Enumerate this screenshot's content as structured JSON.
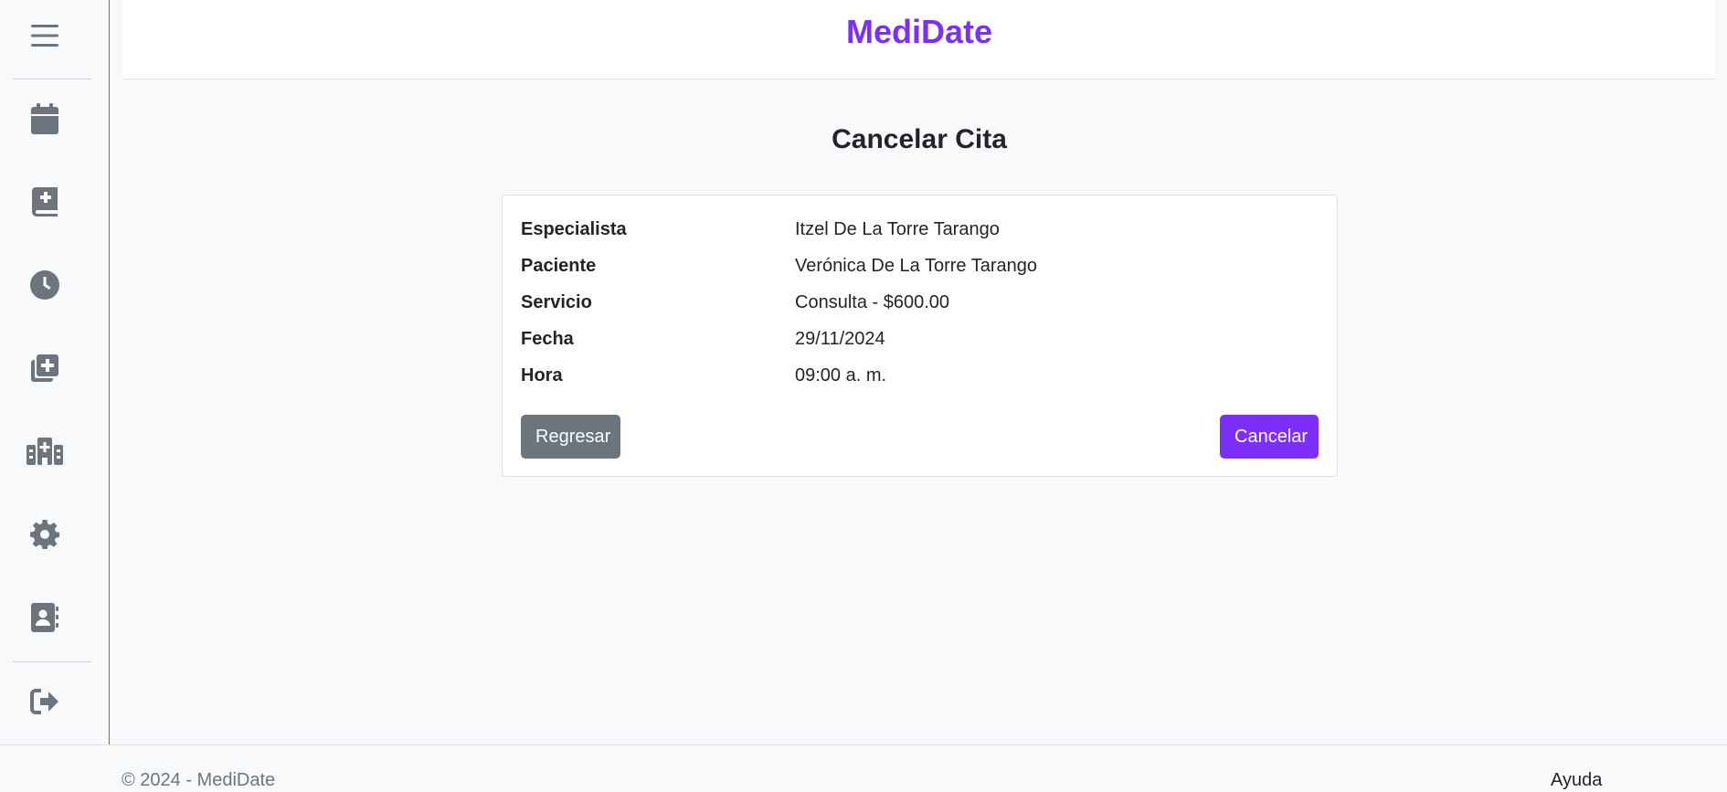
{
  "app": {
    "brand": "MediDate"
  },
  "sidebar": {
    "items": [
      {
        "icon": "menu-icon"
      },
      {
        "icon": "calendar-icon"
      },
      {
        "icon": "medical-book-icon"
      },
      {
        "icon": "clock-icon"
      },
      {
        "icon": "add-copy-icon"
      },
      {
        "icon": "hospital-icon"
      },
      {
        "icon": "gear-icon"
      },
      {
        "icon": "contact-book-icon"
      },
      {
        "icon": "logout-icon"
      }
    ]
  },
  "page": {
    "title": "Cancelar Cita"
  },
  "appointment": {
    "rows": [
      {
        "label": "Especialista",
        "value": "Itzel De La Torre Tarango"
      },
      {
        "label": "Paciente",
        "value": "Verónica De La Torre Tarango"
      },
      {
        "label": "Servicio",
        "value": "Consulta - $600.00"
      },
      {
        "label": "Fecha",
        "value": "29/11/2024"
      },
      {
        "label": "Hora",
        "value": "09:00 a. m."
      }
    ],
    "back_label": "Regresar",
    "cancel_label": "Cancelar"
  },
  "footer": {
    "copyright": "© 2024 - MediDate",
    "help": "Ayuda"
  },
  "colors": {
    "accent": "#7b2ff7",
    "secondary": "#6c757d",
    "background": "#f8f9fa"
  }
}
